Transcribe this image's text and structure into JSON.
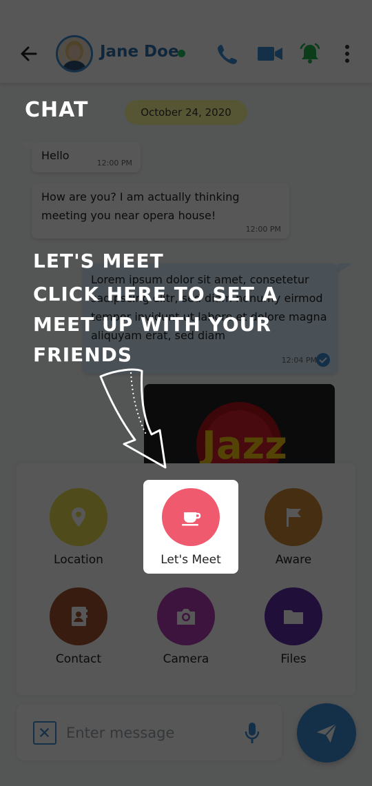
{
  "header": {
    "contact_name": "Jane Doe",
    "online_color": "#22c55e",
    "icons": [
      "back-arrow-icon",
      "phone-icon",
      "video-camera-icon",
      "bell-icon",
      "more-vertical-icon"
    ]
  },
  "chat": {
    "date": "October 24, 2020",
    "messages": [
      {
        "text": "Hello",
        "time": "12:00 PM",
        "direction": "incoming"
      },
      {
        "text": "How are you? I am actually thinking meeting you near opera house!",
        "time": "12:00 PM",
        "direction": "incoming"
      },
      {
        "text": "Lorem ipsum dolor sit amet, consetetur sadipscing elitr, sed diam nonumy eirmod tempor invidunt ut labore et dolore magna aliquyam erat, sed diam",
        "time": "12:04 PM",
        "direction": "outgoing",
        "status": "read"
      }
    ],
    "image_text": "Jazz"
  },
  "attach": {
    "options": [
      {
        "label": "Location",
        "icon": "location-pin-icon",
        "color": "#e6dc4e"
      },
      {
        "label": "Let's Meet",
        "icon": "coffee-cup-icon",
        "color": "#f05a6e"
      },
      {
        "label": "Aware",
        "icon": "flag-icon",
        "color": "#c98732"
      },
      {
        "label": "Contact",
        "icon": "contact-book-icon",
        "color": "#a0522d"
      },
      {
        "label": "Camera",
        "icon": "camera-icon",
        "color": "#b13bb5"
      },
      {
        "label": "Files",
        "icon": "folder-icon",
        "color": "#5b2ea6"
      }
    ]
  },
  "composer": {
    "placeholder": "Enter message",
    "accent": "#3b8ed6"
  },
  "tutorial": {
    "screen_label": "CHAT",
    "title": "LET'S MEET",
    "description": "CLICK HERE TO SET A MEET UP WITH YOUR FRIENDS"
  }
}
